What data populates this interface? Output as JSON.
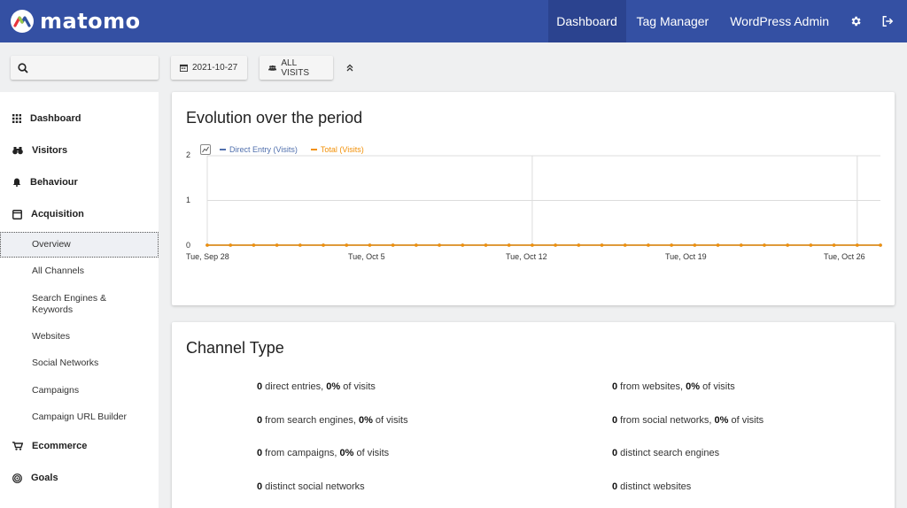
{
  "app": {
    "logo_text": "matomo"
  },
  "topnav": {
    "items": [
      {
        "label": "Dashboard",
        "active": true
      },
      {
        "label": "Tag Manager",
        "active": false
      },
      {
        "label": "WordPress Admin",
        "active": false
      }
    ],
    "icons": [
      "gear-icon",
      "logout-icon"
    ]
  },
  "controls": {
    "search_placeholder": "",
    "date_label": "2021-10-27",
    "segment_label": "ALL VISITS"
  },
  "sidebar": {
    "categories": [
      {
        "label": "Dashboard",
        "icon": "grid-icon"
      },
      {
        "label": "Visitors",
        "icon": "binoculars-icon"
      },
      {
        "label": "Behaviour",
        "icon": "bell-icon"
      },
      {
        "label": "Acquisition",
        "icon": "window-icon"
      },
      {
        "label": "Ecommerce",
        "icon": "cart-icon"
      },
      {
        "label": "Goals",
        "icon": "target-icon"
      }
    ],
    "acquisition_items": [
      {
        "label": "Overview",
        "active": true
      },
      {
        "label": "All Channels"
      },
      {
        "label": "Search Engines & Keywords"
      },
      {
        "label": "Websites"
      },
      {
        "label": "Social Networks"
      },
      {
        "label": "Campaigns"
      },
      {
        "label": "Campaign URL Builder"
      }
    ]
  },
  "evolution": {
    "title": "Evolution over the period",
    "legend": [
      {
        "label": "Direct Entry (Visits)",
        "color": "#5170ad"
      },
      {
        "label": "Total (Visits)",
        "color": "#f29007"
      }
    ]
  },
  "chart_data": {
    "type": "line",
    "title": "Evolution over the period",
    "xlabel": "",
    "ylabel": "",
    "ylim": [
      0,
      2
    ],
    "y_ticks": [
      "2",
      "1",
      "0"
    ],
    "x_tick_labels": [
      "Tue, Sep 28",
      "Tue, Oct 5",
      "Tue, Oct 12",
      "Tue, Oct 19",
      "Tue, Oct 26"
    ],
    "x": [
      "2021-09-28",
      "2021-09-29",
      "2021-09-30",
      "2021-10-01",
      "2021-10-02",
      "2021-10-03",
      "2021-10-04",
      "2021-10-05",
      "2021-10-06",
      "2021-10-07",
      "2021-10-08",
      "2021-10-09",
      "2021-10-10",
      "2021-10-11",
      "2021-10-12",
      "2021-10-13",
      "2021-10-14",
      "2021-10-15",
      "2021-10-16",
      "2021-10-17",
      "2021-10-18",
      "2021-10-19",
      "2021-10-20",
      "2021-10-21",
      "2021-10-22",
      "2021-10-23",
      "2021-10-24",
      "2021-10-25",
      "2021-10-26",
      "2021-10-27"
    ],
    "series": [
      {
        "name": "Direct Entry (Visits)",
        "color": "#5170ad",
        "values": [
          0,
          0,
          0,
          0,
          0,
          0,
          0,
          0,
          0,
          0,
          0,
          0,
          0,
          0,
          0,
          0,
          0,
          0,
          0,
          0,
          0,
          0,
          0,
          0,
          0,
          0,
          0,
          0,
          0,
          0
        ]
      },
      {
        "name": "Total (Visits)",
        "color": "#f29007",
        "values": [
          0,
          0,
          0,
          0,
          0,
          0,
          0,
          0,
          0,
          0,
          0,
          0,
          0,
          0,
          0,
          0,
          0,
          0,
          0,
          0,
          0,
          0,
          0,
          0,
          0,
          0,
          0,
          0,
          0,
          0
        ]
      }
    ],
    "grid": true,
    "legend": "top-left"
  },
  "channel": {
    "title": "Channel Type",
    "left": [
      {
        "num": "0",
        "text": " direct entries, ",
        "pct": "0%",
        "tail": " of visits"
      },
      {
        "num": "0",
        "text": " from search engines, ",
        "pct": "0%",
        "tail": " of visits"
      },
      {
        "num": "0",
        "text": " from campaigns, ",
        "pct": "0%",
        "tail": " of visits"
      },
      {
        "num": "0",
        "text": " distinct social networks",
        "pct": "",
        "tail": ""
      }
    ],
    "right": [
      {
        "num": "0",
        "text": " from websites, ",
        "pct": "0%",
        "tail": " of visits"
      },
      {
        "num": "0",
        "text": " from social networks, ",
        "pct": "0%",
        "tail": " of visits"
      },
      {
        "num": "0",
        "text": " distinct search engines",
        "pct": "",
        "tail": ""
      },
      {
        "num": "0",
        "text": " distinct websites",
        "pct": "",
        "tail": ""
      }
    ]
  }
}
